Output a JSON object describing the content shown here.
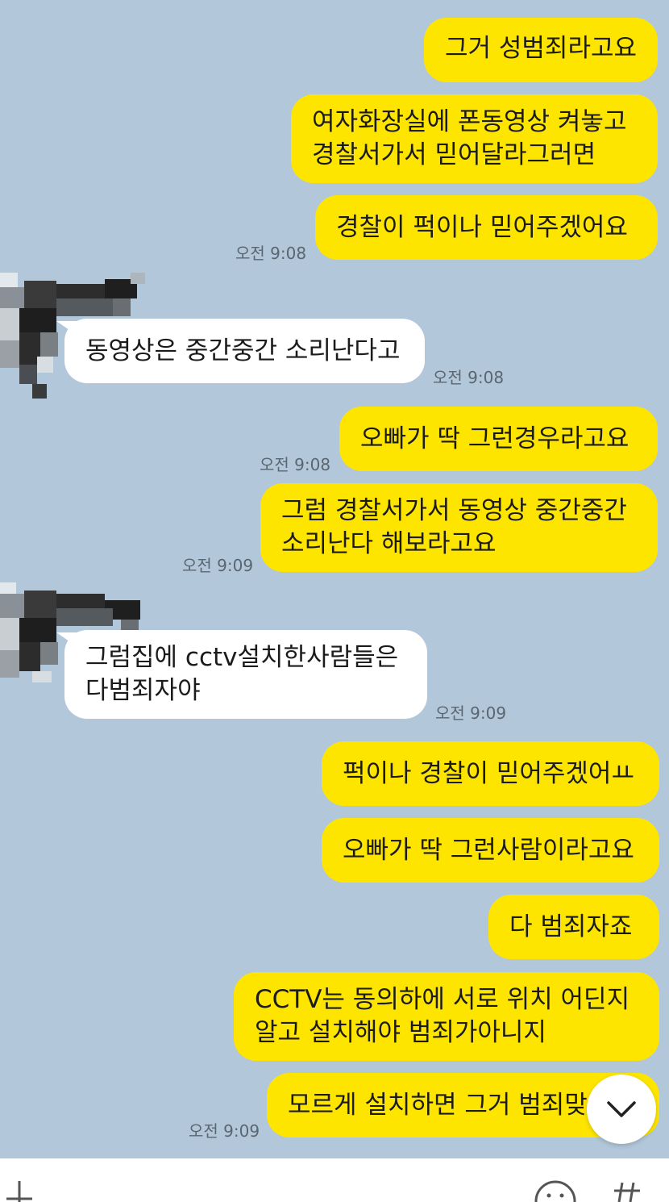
{
  "messages": [
    {
      "id": "m1",
      "sender": "me",
      "lines": [
        "그거 성범죄라고요"
      ]
    },
    {
      "id": "m2",
      "sender": "me",
      "lines": [
        "여자화장실에 폰동영상 켜놓고",
        "경찰서가서 믿어달라그러면"
      ]
    },
    {
      "id": "m3",
      "sender": "me",
      "lines": [
        "경찰이 퍽이나 믿어주겠어요"
      ],
      "time": "오전 9:08"
    },
    {
      "id": "m4",
      "sender": "other",
      "lines": [
        "동영상은 중간중간 소리난다고"
      ],
      "time": "오전 9:08"
    },
    {
      "id": "m5",
      "sender": "me",
      "lines": [
        "오빠가 딱 그런경우라고요"
      ],
      "time": "오전 9:08"
    },
    {
      "id": "m6",
      "sender": "me",
      "lines": [
        "그럼 경찰서가서 동영상 중간중간",
        "소리난다 해보라고요"
      ],
      "time": "오전 9:09"
    },
    {
      "id": "m7",
      "sender": "other",
      "lines": [
        "그럼집에 cctv설치한사람들은",
        "다범죄자야"
      ],
      "time": "오전 9:09"
    },
    {
      "id": "m8",
      "sender": "me",
      "lines": [
        "퍽이나 경찰이 믿어주겠어ㅛ"
      ]
    },
    {
      "id": "m9",
      "sender": "me",
      "lines": [
        "오빠가 딱 그런사람이라고요"
      ]
    },
    {
      "id": "m10",
      "sender": "me",
      "lines": [
        "다 범죄자죠"
      ]
    },
    {
      "id": "m11",
      "sender": "me",
      "lines": [
        "CCTV는 동의하에 서로 위치 어딘지",
        "알고 설치해야 범죄가아니지"
      ]
    },
    {
      "id": "m12",
      "sender": "me",
      "lines": [
        "모르게 설치하면 그거 범죄맞아요"
      ],
      "time": "오전 9:09"
    }
  ],
  "icons": {
    "scroll_down": "chevron-down-icon",
    "attach": "plus-icon",
    "emoji": "emoji-icon",
    "hashtag": "hashtag-icon",
    "avatar": "avatar-pixelated"
  },
  "colors": {
    "background": "#b2c7d9",
    "my_bubble": "#fee500",
    "their_bubble": "#ffffff",
    "timestamp": "#5a6670"
  }
}
